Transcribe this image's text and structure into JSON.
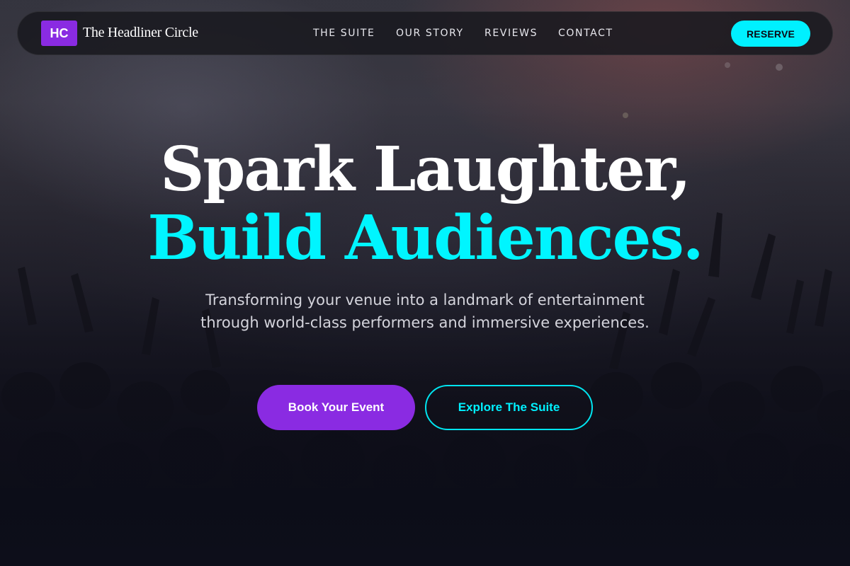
{
  "brand": {
    "badge": "HC",
    "name": "The Headliner Circle",
    "accent": "#8a2be2",
    "highlight": "#00f0ff"
  },
  "nav": {
    "items": [
      {
        "label": "THE SUITE"
      },
      {
        "label": "OUR STORY"
      },
      {
        "label": "REVIEWS"
      },
      {
        "label": "CONTACT"
      }
    ],
    "cta": "RESERVE"
  },
  "hero": {
    "title_line1": "Spark Laughter,",
    "title_line2": "Build Audiences.",
    "subtitle": "Transforming your venue into a landmark of entertainment through world-class performers and immersive experiences.",
    "primary_button": "Book Your Event",
    "secondary_button": "Explore The Suite"
  },
  "background": {
    "image": "concert crowd with raised hands"
  }
}
